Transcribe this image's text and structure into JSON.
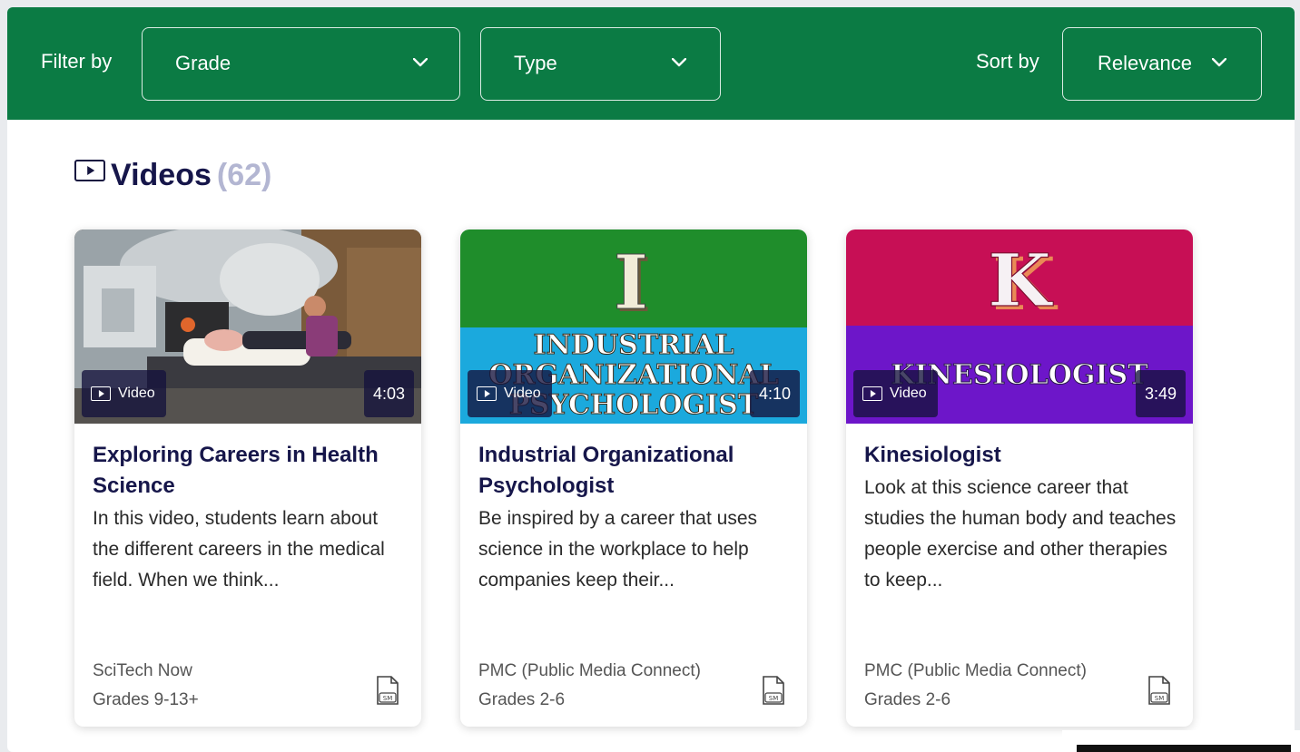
{
  "filter_bar": {
    "filter_label": "Filter by",
    "grade_dropdown": {
      "value": "Grade"
    },
    "type_dropdown": {
      "value": "Type"
    },
    "sort_label": "Sort by",
    "sort_dropdown": {
      "value": "Relevance"
    }
  },
  "section": {
    "icon": "video-icon",
    "title": "Videos",
    "count": "(62)"
  },
  "cards": [
    {
      "type_badge": "Video",
      "duration": "4:03",
      "title": "Exploring Careers in Health Science",
      "description": "In this video, students learn about the different careers in the medical field. When we think...",
      "source": "SciTech Now",
      "grades": "Grades 9-13+",
      "resource_icon": "sm-document-icon"
    },
    {
      "type_badge": "Video",
      "duration": "4:10",
      "thumb_letter": "I",
      "thumb_lines": [
        "INDUSTRIAL",
        "ORGANIZATIONAL",
        "PSYCHOLOGIST"
      ],
      "title": "Industrial Organizational Psychologist",
      "description": "Be inspired by a career that uses science in the workplace to help companies keep their...",
      "source": "PMC (Public Media Connect)",
      "grades": "Grades 2-6",
      "resource_icon": "sm-document-icon"
    },
    {
      "type_badge": "Video",
      "duration": "3:49",
      "thumb_letter": "K",
      "thumb_lines": [
        "KINESIOLOGIST"
      ],
      "title": "Kinesiologist",
      "description": "Look at this science career that studies the human body and teaches people exercise and other therapies to keep...",
      "source": "PMC (Public Media Connect)",
      "grades": "Grades 2-6",
      "resource_icon": "sm-document-icon"
    }
  ],
  "colors": {
    "filter_bar": "#0b7b44",
    "title_navy": "#16164a",
    "count_gray": "#b3b6d2",
    "thumb2_top": "#1f8d2b",
    "thumb2_bottom": "#1ba9dd",
    "thumb3_top": "#c70f55",
    "thumb3_bottom": "#6d16c9"
  }
}
